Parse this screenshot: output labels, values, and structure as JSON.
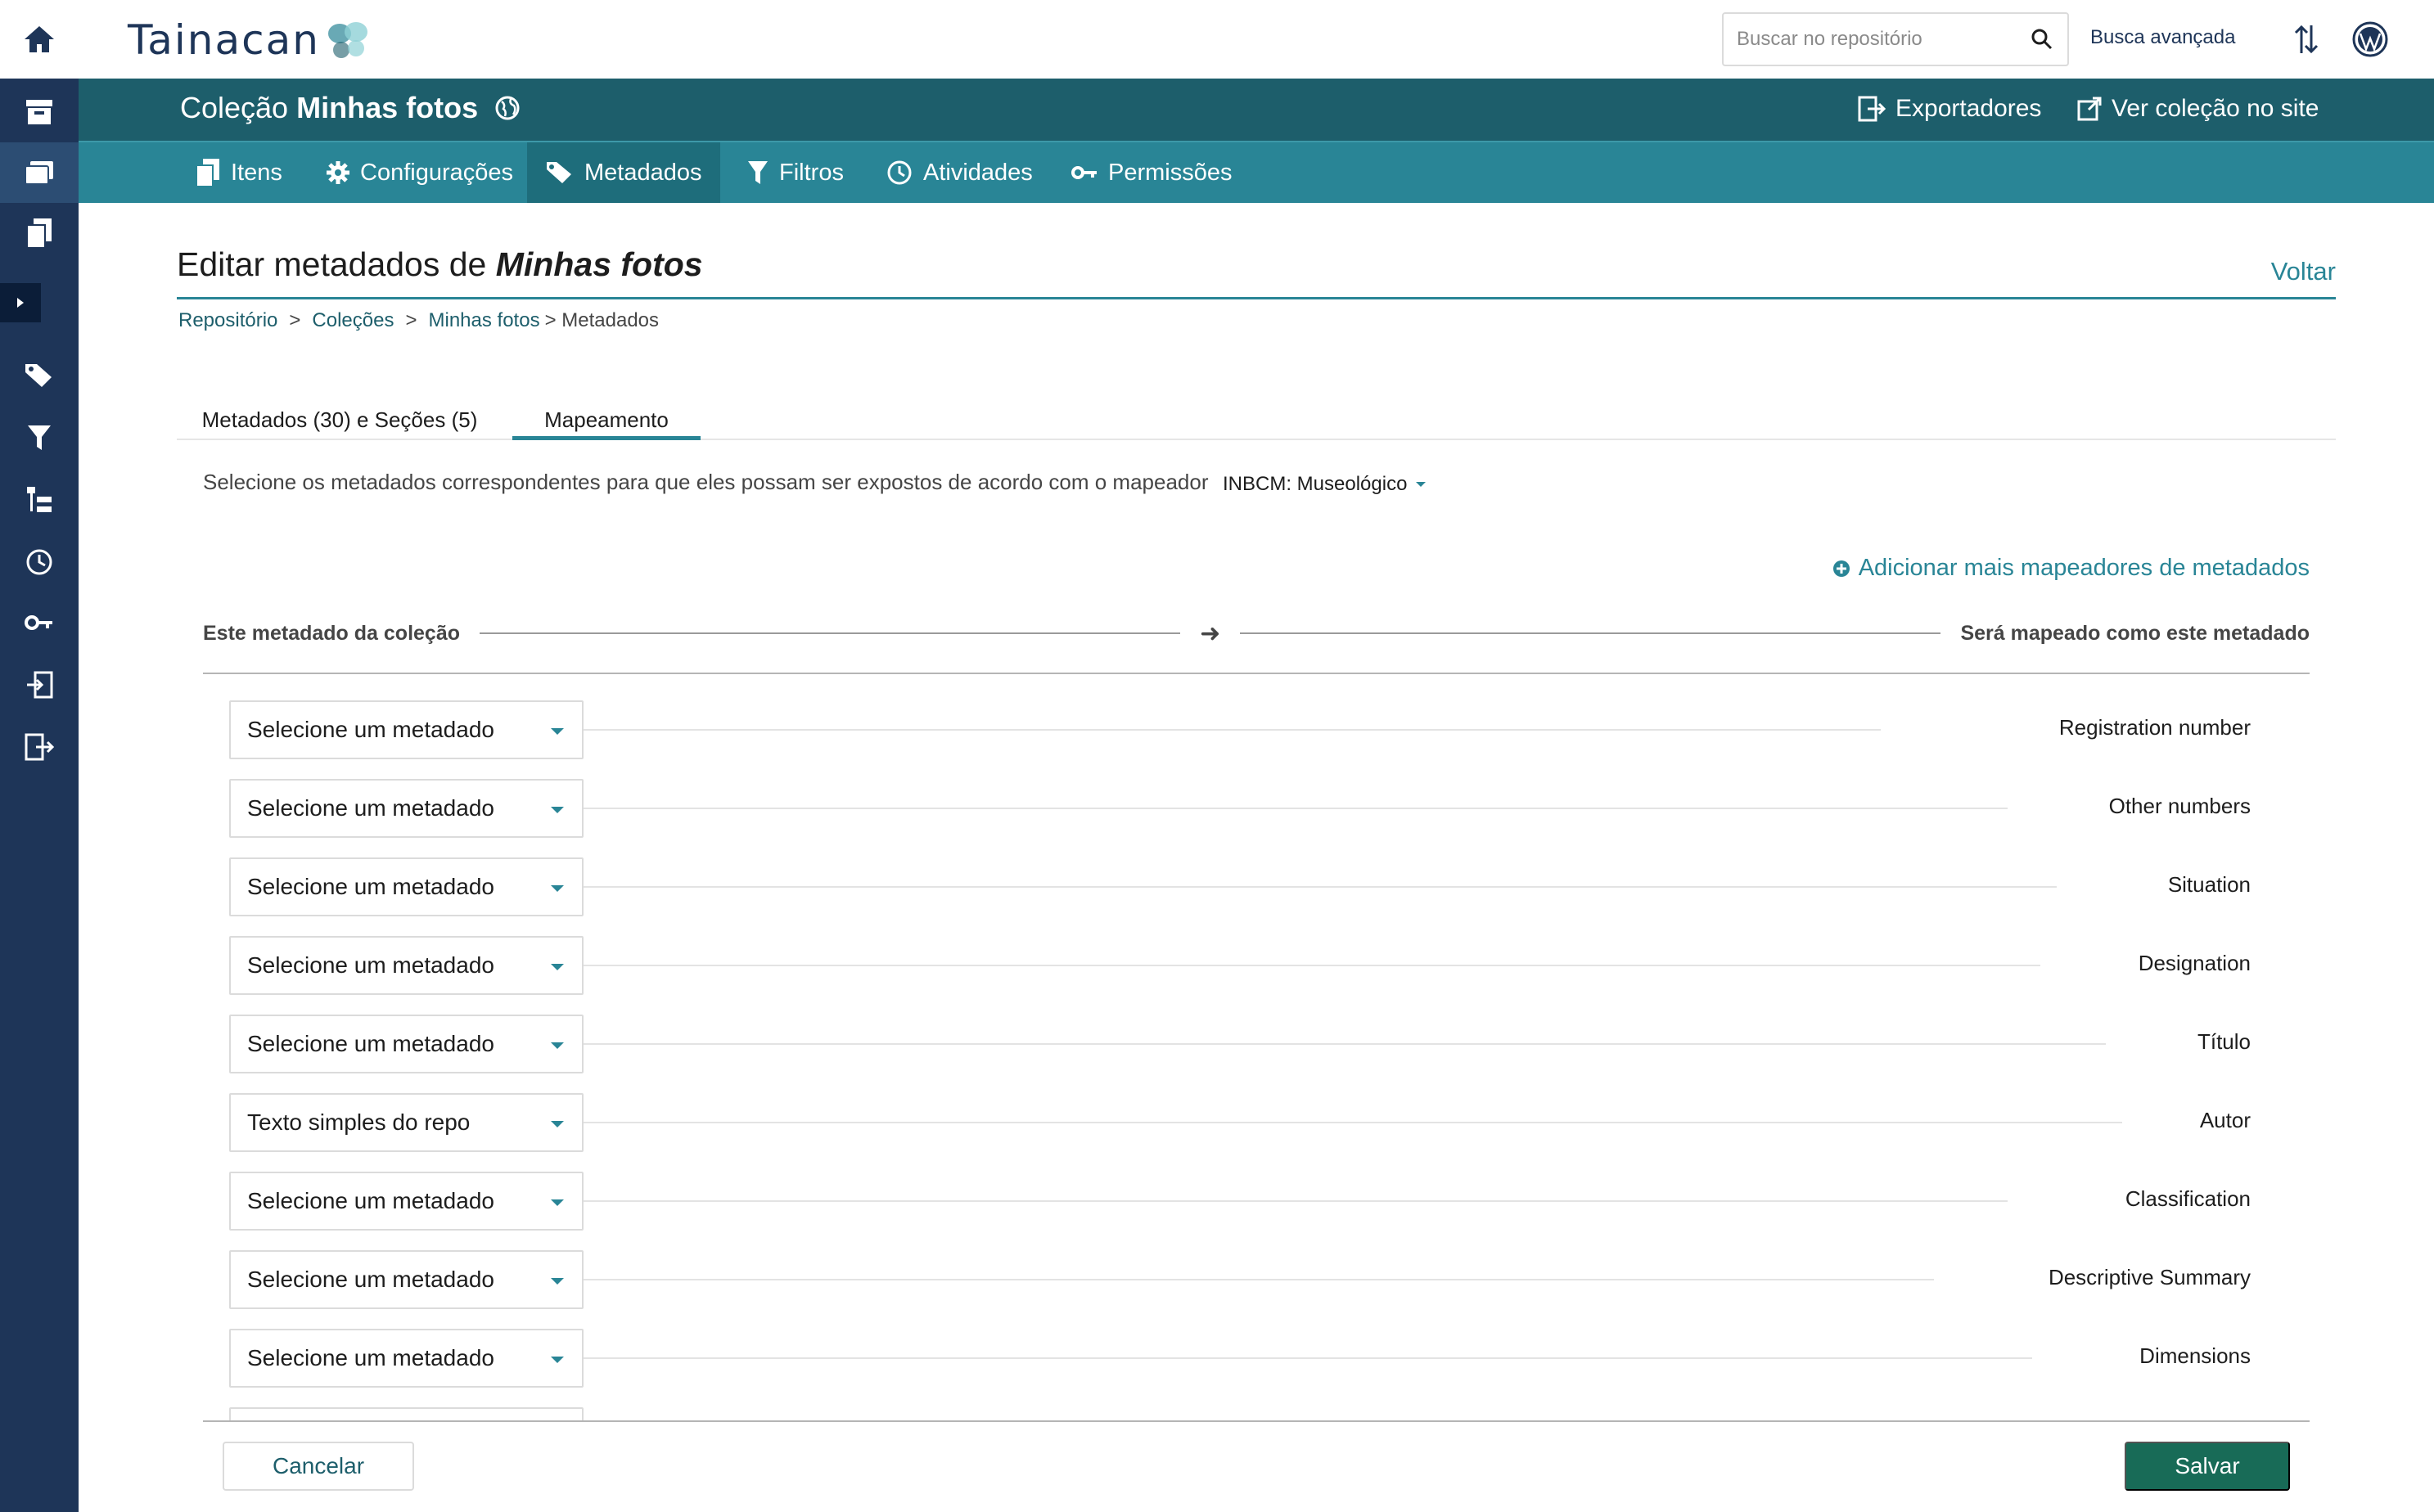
{
  "sidebar": {
    "items": [
      {
        "icon": "home-icon"
      },
      {
        "icon": "repository-archive-icon"
      },
      {
        "icon": "collections-icon"
      },
      {
        "icon": "items-icon"
      },
      {
        "icon": "expand-arrow-icon"
      },
      {
        "icon": "metadata-tags-icon"
      },
      {
        "icon": "filter-icon"
      },
      {
        "icon": "taxonomies-icon"
      },
      {
        "icon": "activities-icon"
      },
      {
        "icon": "permissions-key-icon"
      },
      {
        "icon": "importers-icon"
      },
      {
        "icon": "exporters-icon"
      }
    ]
  },
  "topbar": {
    "logo_text": "Tainacan",
    "search_placeholder": "Buscar no repositório",
    "advanced_search": "Busca avançada"
  },
  "collection": {
    "prefix": "Coleção",
    "name": "Minhas fotos",
    "exporters": "Exportadores",
    "view_on_site": "Ver coleção no site"
  },
  "tabs": [
    {
      "label": "Itens"
    },
    {
      "label": "Configurações"
    },
    {
      "label": "Metadados"
    },
    {
      "label": "Filtros"
    },
    {
      "label": "Atividades"
    },
    {
      "label": "Permissões"
    }
  ],
  "page": {
    "title_prefix": "Editar metadados de",
    "title_collection": "Minhas fotos",
    "back": "Voltar",
    "breadcrumb": [
      "Repositório",
      ">",
      "Coleções",
      ">",
      "Minhas fotos",
      "> Metadados"
    ]
  },
  "subtabs": [
    {
      "label": "Metadados (30) e Seções (5)"
    },
    {
      "label": "Mapeamento"
    }
  ],
  "mapping": {
    "description": "Selecione os metadados correspondentes para que eles possam ser expostos de acordo com o mapeador",
    "mapper": "INBCM: Museológico",
    "add_mappers": "Adicionar mais mapeadores de metadados",
    "left_header": "Este metadado da coleção",
    "arrow": "➜",
    "right_header": "Será mapeado como este metadado",
    "rows": [
      {
        "select": "Selecione um metadado",
        "target": "Registration number"
      },
      {
        "select": "Selecione um metadado",
        "target": "Other numbers"
      },
      {
        "select": "Selecione um metadado",
        "target": "Situation"
      },
      {
        "select": "Selecione um metadado",
        "target": "Designation"
      },
      {
        "select": "Selecione um metadado",
        "target": "Título"
      },
      {
        "select": "Texto simples do repo",
        "target": "Autor"
      },
      {
        "select": "Selecione um metadado",
        "target": "Classification"
      },
      {
        "select": "Selecione um metadado",
        "target": "Descriptive Summary"
      },
      {
        "select": "Selecione um metadado",
        "target": "Dimensions"
      },
      {
        "select": "",
        "target": ""
      }
    ]
  },
  "footer": {
    "cancel": "Cancelar",
    "save": "Salvar"
  },
  "colors": {
    "sidebar": "#1e3558",
    "collection_bar": "#1d5e6b",
    "tabs_bar": "#298596",
    "save_button": "#186b57"
  }
}
